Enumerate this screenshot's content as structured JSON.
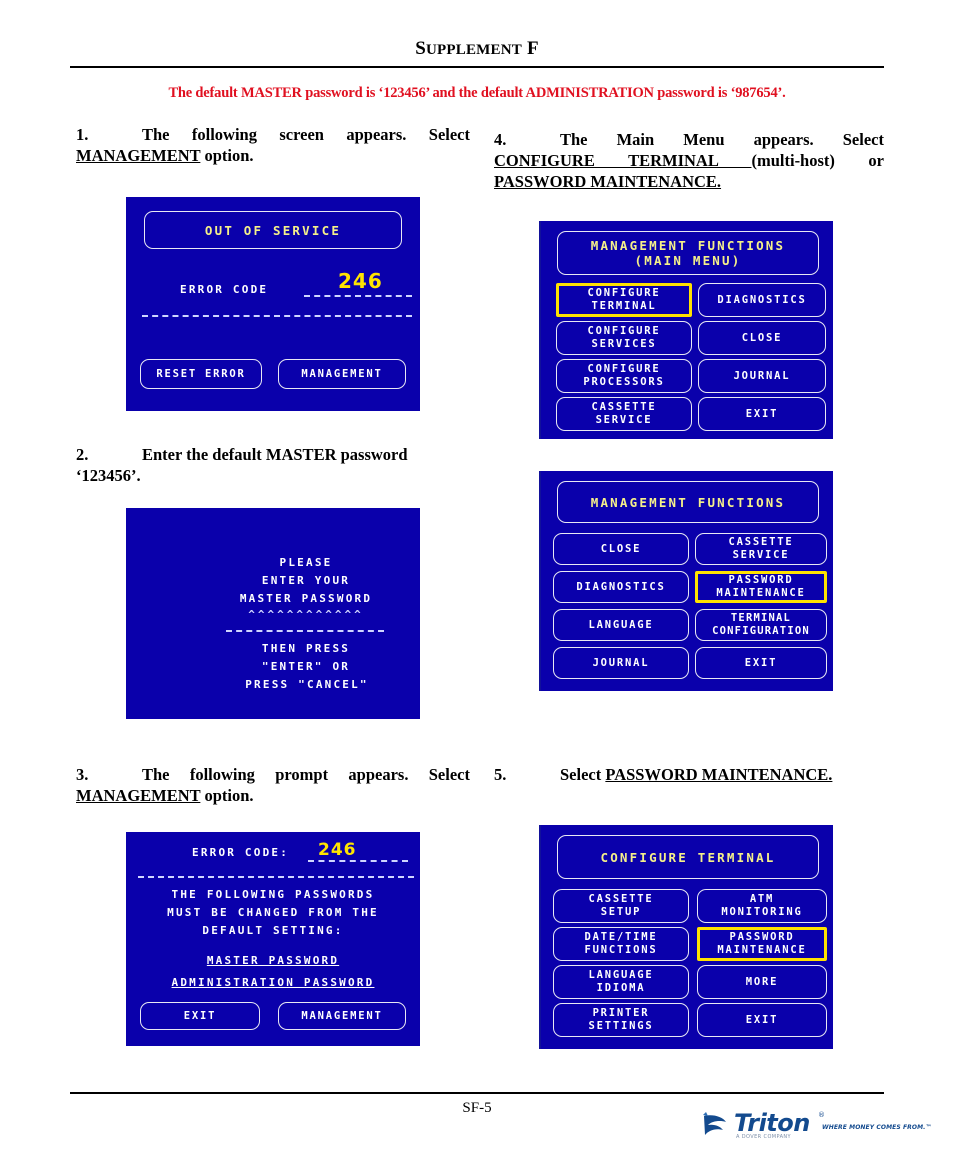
{
  "header": {
    "title_main": "S",
    "title_rest": "UPPLEMENT",
    "title_letter": "F",
    "title_full": "Supplement F"
  },
  "notice": "The default MASTER password is ‘123456’ and the default ADMINISTRATION password is ‘987654’.",
  "steps": {
    "s1": {
      "num": "1.",
      "text_a": "The following screen appears.  Select ",
      "text_b": "MANAGEMENT",
      "text_c": " option."
    },
    "s2": {
      "num": "2.",
      "text_a": "Enter the default MASTER password ‘123456’."
    },
    "s3": {
      "num": "3.",
      "text_a": "The following prompt appears.  Select ",
      "text_b": "MANAGEMENT",
      "text_c": " option."
    },
    "s4": {
      "num": "4.",
      "text_a": "The Main Menu appears.  Select ",
      "text_b": "CONFIGURE TERMINAL ",
      "text_c": "(multi-host) or ",
      "text_d": "PASSWORD MAINTENANCE."
    },
    "s5": {
      "num": "5.",
      "text_a": "Select ",
      "text_b": "PASSWORD MAINTENANCE."
    }
  },
  "screens": {
    "out_of_service": {
      "title": "OUT OF SERVICE",
      "error_label": "ERROR CODE",
      "error_code": "246",
      "buttons": [
        {
          "label": "RESET ERROR",
          "highlighted": false
        },
        {
          "label": "MANAGEMENT",
          "highlighted": false
        }
      ]
    },
    "password_prompt": {
      "lines": [
        "PLEASE",
        "ENTER YOUR",
        "MASTER PASSWORD"
      ],
      "masked": "^^^^^^^^^^^^",
      "lines2": [
        "THEN PRESS",
        "\"ENTER\" OR",
        "PRESS \"CANCEL\""
      ]
    },
    "error_prompt": {
      "error_label": "ERROR CODE:",
      "error_code": "246",
      "body": [
        "THE FOLLOWING PASSWORDS",
        "MUST BE CHANGED FROM THE",
        "DEFAULT SETTING:"
      ],
      "items": [
        "MASTER PASSWORD",
        "ADMINISTRATION PASSWORD"
      ],
      "buttons": [
        {
          "label": "EXIT",
          "highlighted": false
        },
        {
          "label": "MANAGEMENT",
          "highlighted": false
        }
      ]
    },
    "main_menu": {
      "title_line1": "MANAGEMENT FUNCTIONS",
      "title_line2": "(MAIN MENU)",
      "buttons_left": [
        {
          "line1": "CONFIGURE",
          "line2": "TERMINAL",
          "highlighted": true
        },
        {
          "line1": "CONFIGURE",
          "line2": "SERVICES",
          "highlighted": false
        },
        {
          "line1": "CONFIGURE",
          "line2": "PROCESSORS",
          "highlighted": false
        },
        {
          "line1": "CASSETTE",
          "line2": "SERVICE",
          "highlighted": false
        }
      ],
      "buttons_right": [
        {
          "line1": "DIAGNOSTICS",
          "line2": "",
          "highlighted": false
        },
        {
          "line1": "CLOSE",
          "line2": "",
          "highlighted": false
        },
        {
          "line1": "JOURNAL",
          "line2": "",
          "highlighted": false
        },
        {
          "line1": "EXIT",
          "line2": "",
          "highlighted": false
        }
      ]
    },
    "management_functions": {
      "title_line1": "MANAGEMENT FUNCTIONS",
      "title_line2": "",
      "buttons_left": [
        {
          "line1": "CLOSE",
          "line2": "",
          "highlighted": false
        },
        {
          "line1": "DIAGNOSTICS",
          "line2": "",
          "highlighted": false
        },
        {
          "line1": "LANGUAGE",
          "line2": "",
          "highlighted": false
        },
        {
          "line1": "JOURNAL",
          "line2": "",
          "highlighted": false
        }
      ],
      "buttons_right": [
        {
          "line1": "CASSETTE",
          "line2": "SERVICE",
          "highlighted": false
        },
        {
          "line1": "PASSWORD",
          "line2": "MAINTENANCE",
          "highlighted": true
        },
        {
          "line1": "TERMINAL",
          "line2": "CONFIGURATION",
          "highlighted": false
        },
        {
          "line1": "EXIT",
          "line2": "",
          "highlighted": false
        }
      ]
    },
    "configure_terminal": {
      "title_line1": "CONFIGURE TERMINAL",
      "title_line2": "",
      "buttons_left": [
        {
          "line1": "CASSETTE",
          "line2": "SETUP",
          "highlighted": false
        },
        {
          "line1": "DATE/TIME",
          "line2": "FUNCTIONS",
          "highlighted": false
        },
        {
          "line1": "LANGUAGE",
          "line2": "IDIOMA",
          "highlighted": false
        },
        {
          "line1": "PRINTER",
          "line2": "SETTINGS",
          "highlighted": false
        }
      ],
      "buttons_right": [
        {
          "line1": "ATM",
          "line2": "MONITORING",
          "highlighted": false
        },
        {
          "line1": "PASSWORD",
          "line2": "MAINTENANCE",
          "highlighted": true
        },
        {
          "line1": "MORE",
          "line2": "",
          "highlighted": false
        },
        {
          "line1": "EXIT",
          "line2": "",
          "highlighted": false
        }
      ]
    }
  },
  "footer": {
    "folio": "SF-5",
    "logo_word": "Triton",
    "logo_reg": "®",
    "logo_tagline": "WHERE MONEY COMES FROM.™",
    "logo_sub": "A DOVER COMPANY"
  },
  "colors": {
    "screen_bg": "#0a00ab",
    "screen_border": "#e8e8f4",
    "highlight": "#ffe200",
    "title_text": "#f5f08a",
    "notice_red": "#e01020",
    "logo_blue": "#134a8e"
  }
}
